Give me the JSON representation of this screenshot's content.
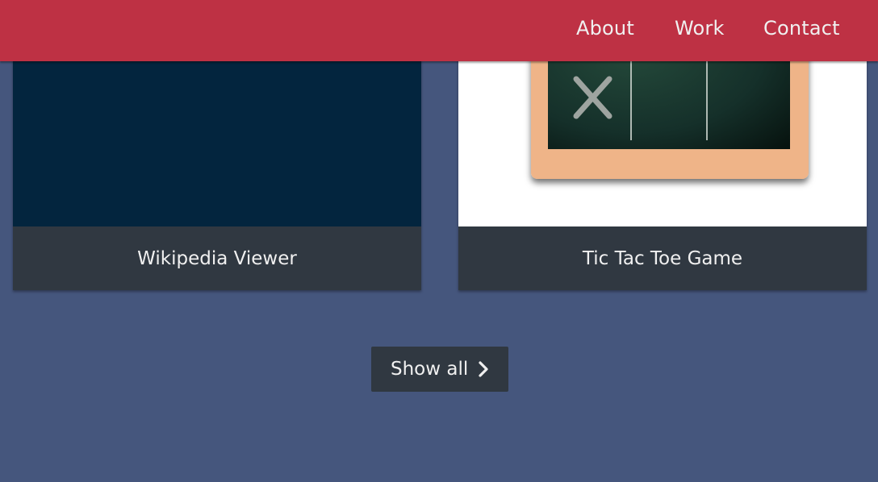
{
  "nav": {
    "links": [
      {
        "label": "About"
      },
      {
        "label": "Work"
      },
      {
        "label": "Contact"
      }
    ]
  },
  "projects": [
    {
      "title": "Wikipedia Viewer",
      "image": "dark-navy-thumbnail"
    },
    {
      "title": "Tic Tac Toe Game",
      "image": "chalkboard-tic-tac-toe-thumbnail"
    }
  ],
  "show_all": {
    "label": "Show all",
    "icon": "chevron-right-icon"
  },
  "colors": {
    "nav_background": "#be3144",
    "page_background": "#45567d",
    "tile_caption_background": "#303841",
    "text_light": "#f0f0f0",
    "chalkboard_frame": "#efb488",
    "chalkboard_surface": "#1e3a2c"
  }
}
